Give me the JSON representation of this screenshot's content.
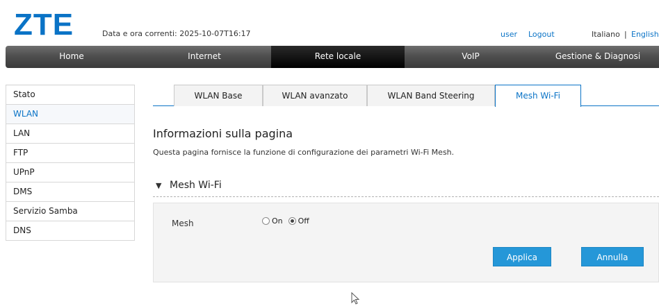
{
  "header": {
    "logo": "ZTE",
    "datetime": "Data e ora correnti: 2025-10-07T16:17",
    "user": "user",
    "logout": "Logout",
    "lang_it": "Italiano",
    "lang_sep": "|",
    "lang_en": "English"
  },
  "nav": {
    "items": [
      {
        "label": "Home"
      },
      {
        "label": "Internet"
      },
      {
        "label": "Rete locale"
      },
      {
        "label": "VoIP"
      },
      {
        "label": "Gestione & Diagnosi"
      }
    ],
    "active": "Rete locale"
  },
  "sidebar": {
    "items": [
      {
        "label": "Stato"
      },
      {
        "label": "WLAN"
      },
      {
        "label": "LAN"
      },
      {
        "label": "FTP"
      },
      {
        "label": "UPnP"
      },
      {
        "label": "DMS"
      },
      {
        "label": "Servizio Samba"
      },
      {
        "label": "DNS"
      }
    ],
    "active": "WLAN"
  },
  "tabs": {
    "items": [
      {
        "label": "WLAN Base"
      },
      {
        "label": "WLAN avanzato"
      },
      {
        "label": "WLAN Band Steering"
      },
      {
        "label": "Mesh Wi-Fi"
      }
    ],
    "active": "Mesh Wi-Fi"
  },
  "main": {
    "title": "Informazioni sulla pagina",
    "description": "Questa pagina fornisce la funzione di configurazione dei parametri Wi-Fi Mesh.",
    "section_arrow": "▼",
    "section_title": "Mesh Wi-Fi",
    "mesh_label": "Mesh",
    "mesh_on": "On",
    "mesh_off": "Off",
    "mesh_value": "Off",
    "apply_button": "Applica",
    "cancel_button": "Annulla"
  },
  "colors": {
    "brand": "#0a73c6",
    "button": "#2597d8",
    "nav_bg": "#4f4f4f"
  }
}
